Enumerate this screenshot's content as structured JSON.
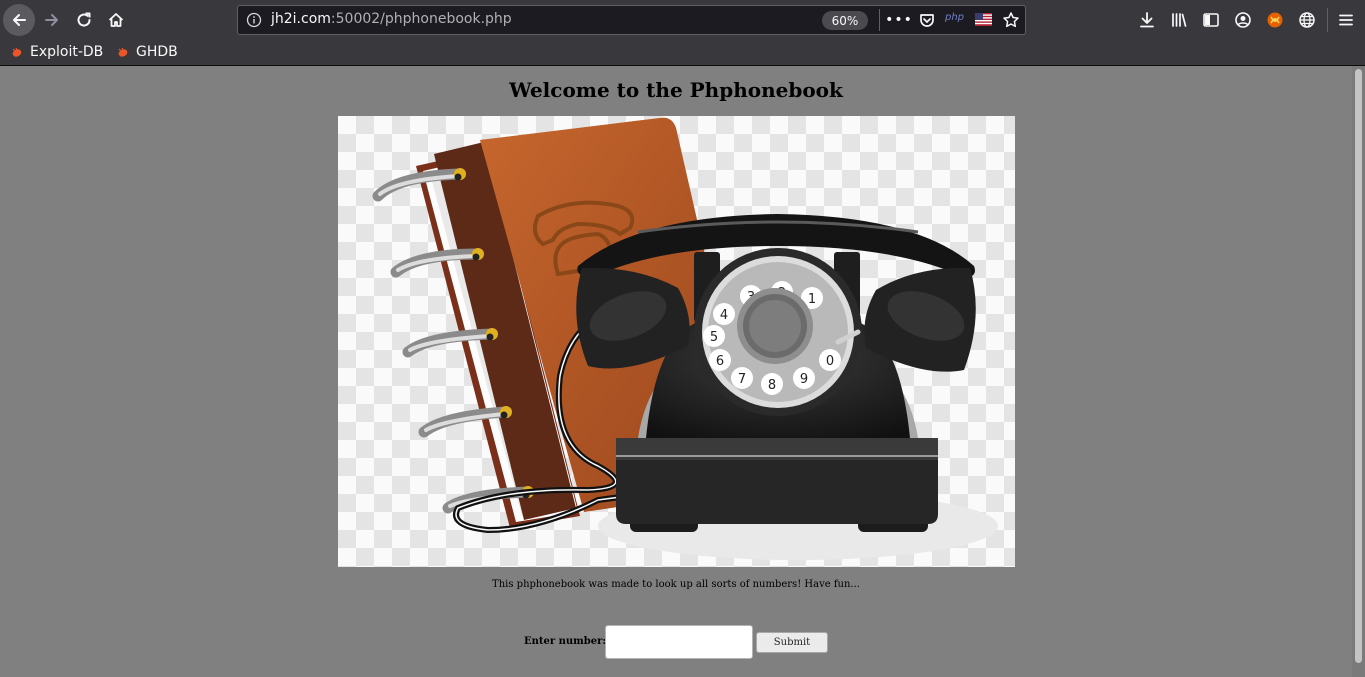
{
  "browser": {
    "url_host": "jh2i.com",
    "url_path": ":50002/phphonebook.php",
    "zoom": "60%",
    "php_badge": "php",
    "toolbar_icons": [
      "back-icon",
      "forward-icon",
      "reload-icon",
      "home-icon",
      "info-icon",
      "page-actions-icon",
      "pocket-icon",
      "php-icon",
      "us-flag-icon",
      "star-icon",
      "downloads-icon",
      "library-icon",
      "sidebar-icon",
      "account-icon",
      "extension-fox-icon",
      "globe-icon",
      "menu-icon"
    ],
    "colors": {
      "chrome": "#38383d",
      "urlbar": "#1c1b22",
      "text": "#f9f9fa"
    }
  },
  "bookmarks": [
    {
      "label": "Exploit-DB"
    },
    {
      "label": "GHDB"
    }
  ],
  "page": {
    "title": "Welcome to the Phphonebook",
    "tagline": "This phphonebook was made to look up all sorts of numbers! Have fun...",
    "form": {
      "label": "Enter number:",
      "input_value": "",
      "submit_label": "Submit"
    },
    "dial_digits": [
      "1",
      "2",
      "3",
      "4",
      "5",
      "6",
      "7",
      "8",
      "9",
      "0"
    ],
    "colors": {
      "background": "#808080"
    }
  }
}
